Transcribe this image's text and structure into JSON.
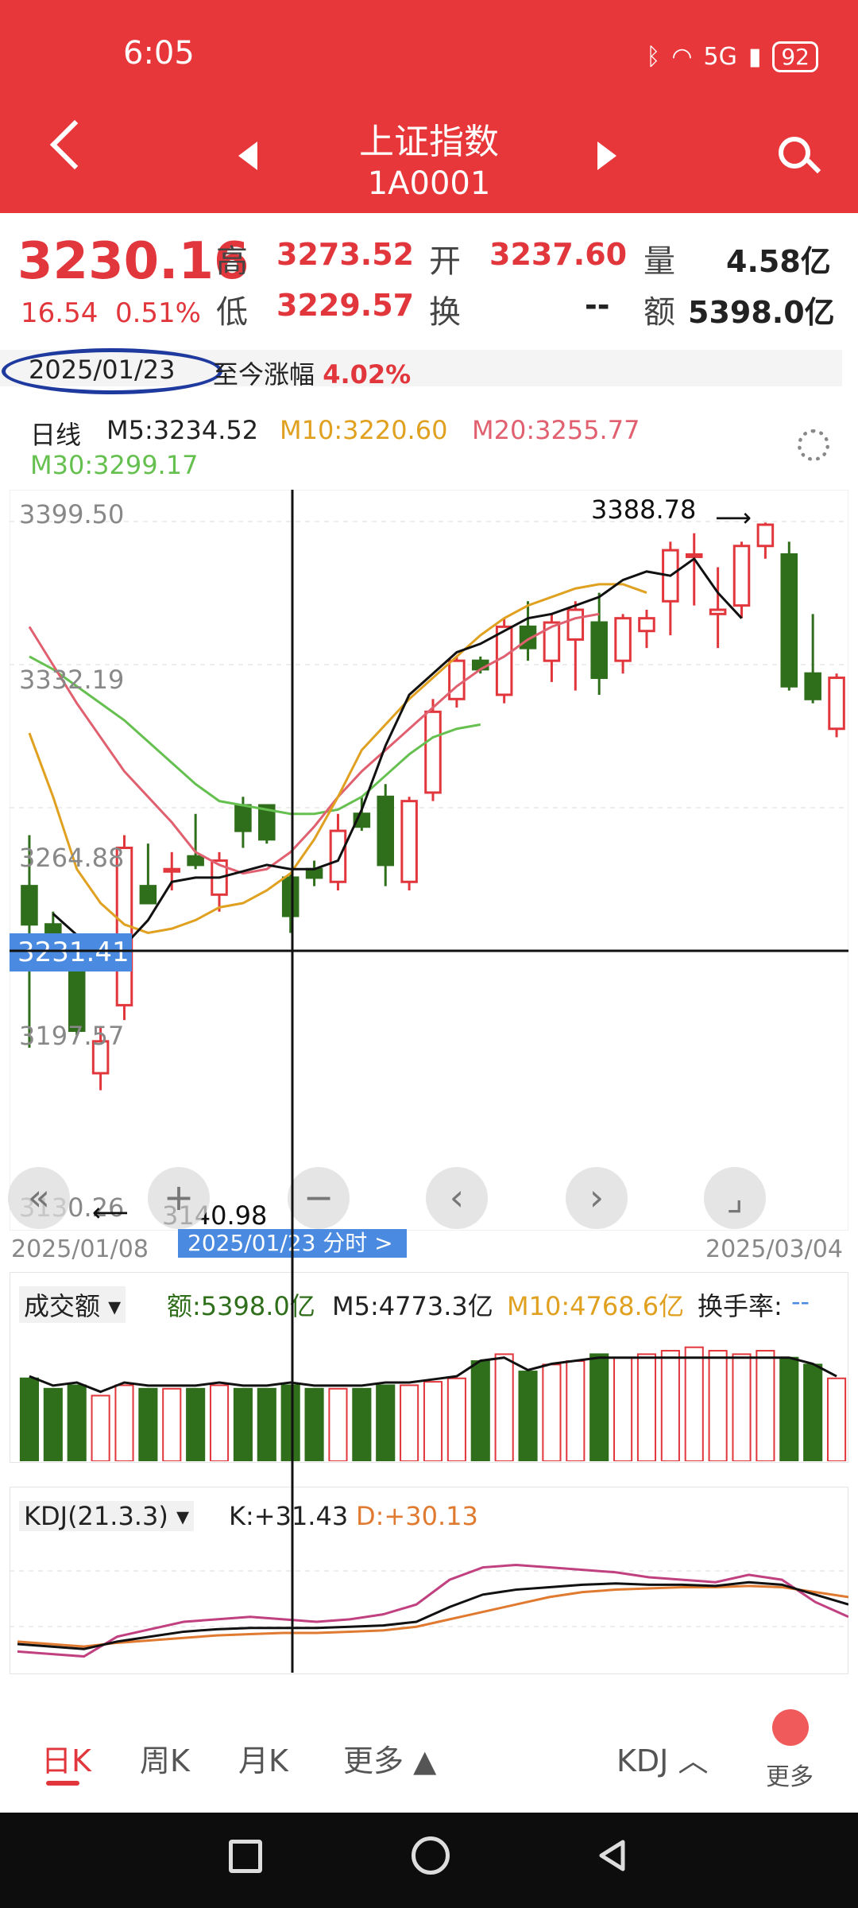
{
  "status_bar": {
    "time": "6:05",
    "battery": "92",
    "network": "5G"
  },
  "header": {
    "title": "上证指数",
    "code": "1A0001"
  },
  "quote": {
    "price": "3230.16",
    "change": "16.54",
    "change_pct": "0.51%",
    "high_label": "高",
    "high": "3273.52",
    "open_label": "开",
    "open": "3237.60",
    "volume_label": "量",
    "volume": "4.58亿",
    "low_label": "低",
    "low": "3229.57",
    "turnover_label": "换",
    "turnover": "--",
    "amount_label": "额",
    "amount": "5398.0亿"
  },
  "date_row": {
    "date": "2025/01/23",
    "since_label": "至今涨幅",
    "since_value": "4.02%"
  },
  "ma_legend": {
    "period": "日线",
    "m5": "M5:3234.52",
    "m10": "M10:3220.60",
    "m20": "M20:3255.77",
    "m30": "M30:3299.17"
  },
  "main_chart": {
    "y_ticks": [
      "3399.50",
      "3332.19",
      "3264.88",
      "3197.57",
      "3130.26"
    ],
    "cross_price": "3231.41",
    "high_annotation": "3388.78",
    "low_annotation": "3140.98",
    "start_date": "2025/01/08",
    "end_date": "2025/03/04",
    "cursor_badge": "2025/01/23  分时  >",
    "controls": {
      "left_double": "«",
      "zoom_in": "+",
      "zoom_out": "−",
      "prev": "‹",
      "next": "›",
      "fullscreen": "⌟"
    }
  },
  "volume_panel": {
    "selector": "成交额 ▾",
    "amount": "额:5398.0亿",
    "m5": "M5:4773.3亿",
    "m10": "M10:4768.6亿",
    "turnover_label": "换手率:",
    "turnover_value": "--"
  },
  "kdj_panel": {
    "selector": "KDJ(21.3.3) ▾",
    "k": "K:+31.43",
    "d": "D:+30.13"
  },
  "bottom_tabs": {
    "day": "日K",
    "week": "周K",
    "month": "月K",
    "more": "更多 ▲",
    "indicator": "KDJ ︿",
    "more_btn": "更多"
  },
  "colors": {
    "header": "#e8373a",
    "up": "#e1363c",
    "down": "#2f6e1a",
    "m5": "#111111",
    "m10": "#e0a020",
    "m20": "#e06070",
    "m30": "#66c050"
  },
  "chart_data": {
    "type": "candlestick",
    "candles": [
      {
        "o": 3228,
        "h": 3252,
        "l": 3152,
        "c": 3210
      },
      {
        "o": 3210,
        "h": 3216,
        "l": 3196,
        "c": 3200
      },
      {
        "o": 3196,
        "h": 3198,
        "l": 3158,
        "c": 3160
      },
      {
        "o": 3140,
        "h": 3162,
        "l": 3132,
        "c": 3155
      },
      {
        "o": 3172,
        "h": 3252,
        "l": 3165,
        "c": 3246
      },
      {
        "o": 3228,
        "h": 3248,
        "l": 3220,
        "c": 3220
      },
      {
        "o": 3236,
        "h": 3244,
        "l": 3226,
        "c": 3236
      },
      {
        "o": 3242,
        "h": 3262,
        "l": 3236,
        "c": 3238
      },
      {
        "o": 3224,
        "h": 3244,
        "l": 3216,
        "c": 3240
      },
      {
        "o": 3266,
        "h": 3270,
        "l": 3246,
        "c": 3254
      },
      {
        "o": 3266,
        "h": 3266,
        "l": 3248,
        "c": 3250
      },
      {
        "o": 3232,
        "h": 3234,
        "l": 3206,
        "c": 3214
      },
      {
        "o": 3236,
        "h": 3240,
        "l": 3228,
        "c": 3232
      },
      {
        "o": 3230,
        "h": 3262,
        "l": 3226,
        "c": 3254
      },
      {
        "o": 3262,
        "h": 3270,
        "l": 3254,
        "c": 3256
      },
      {
        "o": 3270,
        "h": 3276,
        "l": 3228,
        "c": 3238
      },
      {
        "o": 3230,
        "h": 3270,
        "l": 3226,
        "c": 3268
      },
      {
        "o": 3272,
        "h": 3316,
        "l": 3268,
        "c": 3310
      },
      {
        "o": 3316,
        "h": 3336,
        "l": 3312,
        "c": 3334
      },
      {
        "o": 3334,
        "h": 3336,
        "l": 3328,
        "c": 3330
      },
      {
        "o": 3318,
        "h": 3354,
        "l": 3314,
        "c": 3350
      },
      {
        "o": 3350,
        "h": 3362,
        "l": 3334,
        "c": 3340
      },
      {
        "o": 3334,
        "h": 3356,
        "l": 3324,
        "c": 3352
      },
      {
        "o": 3344,
        "h": 3362,
        "l": 3320,
        "c": 3358
      },
      {
        "o": 3352,
        "h": 3366,
        "l": 3318,
        "c": 3326
      },
      {
        "o": 3334,
        "h": 3356,
        "l": 3328,
        "c": 3354
      },
      {
        "o": 3348,
        "h": 3358,
        "l": 3340,
        "c": 3354
      },
      {
        "o": 3362,
        "h": 3390,
        "l": 3346,
        "c": 3386
      },
      {
        "o": 3384,
        "h": 3394,
        "l": 3360,
        "c": 3384
      },
      {
        "o": 3356,
        "h": 3378,
        "l": 3340,
        "c": 3358
      },
      {
        "o": 3360,
        "h": 3390,
        "l": 3354,
        "c": 3388
      },
      {
        "o": 3388,
        "h": 3399,
        "l": 3382,
        "c": 3398
      },
      {
        "o": 3384,
        "h": 3390,
        "l": 3320,
        "c": 3322
      },
      {
        "o": 3328,
        "h": 3356,
        "l": 3314,
        "c": 3316
      },
      {
        "o": 3302,
        "h": 3328,
        "l": 3298,
        "c": 3326
      }
    ],
    "ma5": [
      3215,
      3205,
      3200,
      3200,
      3212,
      3230,
      3232,
      3232,
      3235,
      3238,
      3236,
      3236,
      3240,
      3264,
      3294,
      3318,
      3328,
      3338,
      3342,
      3348,
      3354,
      3356,
      3360,
      3364,
      3372,
      3376,
      3374,
      3382,
      3366,
      3354
    ],
    "ma10": [
      3300,
      3270,
      3236,
      3220,
      3210,
      3206,
      3208,
      3212,
      3218,
      3220,
      3226,
      3234,
      3250,
      3270,
      3292,
      3304,
      3316,
      3326,
      3336,
      3346,
      3354,
      3360,
      3364,
      3368,
      3370,
      3370,
      3366
    ],
    "ma20": [
      3350,
      3332,
      3314,
      3298,
      3282,
      3270,
      3258,
      3244,
      3238,
      3234,
      3236,
      3244,
      3256,
      3270,
      3282,
      3292,
      3302,
      3312,
      3322,
      3330,
      3336,
      3344,
      3350,
      3354,
      3356
    ],
    "ma30": [
      3336,
      3330,
      3322,
      3314,
      3306,
      3296,
      3286,
      3276,
      3268,
      3266,
      3264,
      3262,
      3262,
      3264,
      3270,
      3280,
      3290,
      3298,
      3302,
      3304
    ],
    "volume_amount": [
      48,
      42,
      44,
      38,
      44,
      42,
      42,
      42,
      44,
      42,
      42,
      44,
      42,
      42,
      42,
      44,
      44,
      46,
      48,
      58,
      62,
      52,
      56,
      58,
      62,
      60,
      62,
      64,
      66,
      64,
      62,
      64,
      60,
      56,
      48
    ],
    "kdj": {
      "k": [
        18,
        16,
        14,
        20,
        24,
        28,
        30,
        31,
        31,
        31,
        32,
        33,
        36,
        48,
        58,
        62,
        64,
        66,
        67,
        66,
        66,
        65,
        68,
        66,
        58,
        50
      ],
      "d": [
        20,
        18,
        16,
        19,
        21,
        23,
        25,
        26,
        27,
        27,
        28,
        29,
        32,
        38,
        44,
        50,
        56,
        60,
        62,
        63,
        64,
        64,
        65,
        64,
        60,
        56
      ],
      "j": [
        12,
        10,
        8,
        24,
        30,
        36,
        38,
        40,
        38,
        36,
        38,
        42,
        50,
        70,
        80,
        82,
        80,
        78,
        76,
        72,
        70,
        68,
        74,
        70,
        52,
        40
      ]
    }
  }
}
